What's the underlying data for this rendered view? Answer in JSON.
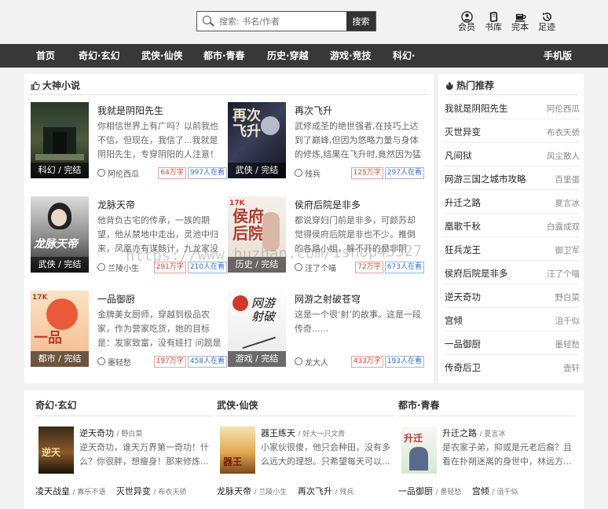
{
  "header": {
    "search_placeholder": "搜索: 书名/作者",
    "search_button": "搜索",
    "user_links": [
      {
        "label": "会员",
        "icon": "user-icon"
      },
      {
        "label": "书库",
        "icon": "book-icon"
      },
      {
        "label": "完本",
        "icon": "cup-icon"
      },
      {
        "label": "足迹",
        "icon": "history-icon"
      }
    ]
  },
  "nav": {
    "items": [
      "首页",
      "奇幻·玄幻",
      "武侠·仙侠",
      "都市·青春",
      "历史·穿越",
      "游戏·竞技",
      "科幻·"
    ],
    "mobile": "手机版"
  },
  "featured": {
    "title": "大神小说",
    "books": [
      {
        "title": "我就是阴阳先生",
        "desc": "你相信世界上有广吗？以前我也不信，但现在，我信了...我就是阴阳先生，专穿阴阳的人注意！书中...",
        "author": "阿伦西瓜",
        "words": "64万字",
        "readers": "997人在看",
        "tag": "科幻 / 完结"
      },
      {
        "title": "再次飞升",
        "desc": "武修成圣的绝世强者,在技巧上达到了巅峰,但因为悠略力量与身体的修炼,结果在飞升时,竟然因为猛烈的...",
        "author": "残兵",
        "words": "125万字",
        "readers": "297人在看",
        "tag": "武侠 / 完结"
      },
      {
        "title": "龙脉天帝",
        "desc": "他背负古宅的传承，一族的期望，他从禁地中走出，灵池中归来，凤凰亦有谋骸计，九龙家没有骚...",
        "author": "兰陵小生",
        "words": "291万字",
        "readers": "210人在看",
        "tag": "武侠 / 完结"
      },
      {
        "title": "侯府后院是非多",
        "desc": "都说穿妇门前是非多，可颜苏却觉得侯府后院是非也不少。推倒的各路小姐，躲不开的是非阴谋，我...",
        "author": "汪了个喵",
        "words": "72万字",
        "readers": "673人在看",
        "tag": "历史 / 完结"
      },
      {
        "title": "一品御厨",
        "desc": "金牌美女厨师，穿越到极品农家，作为营家吃货，她的目标是：发家致富，没有娃打 问题是身边有许...",
        "author": "墨轻愁",
        "words": "197万字",
        "readers": "458人在看",
        "tag": "都市 / 完结"
      },
      {
        "title": "网游之射破苍穹",
        "desc": "这是一个很‘射’的故事。这是一段传奇......",
        "author": "龙大人",
        "words": "433万字",
        "readers": "193人在看",
        "tag": "游戏 / 完结"
      }
    ]
  },
  "hot": {
    "title": "热门推荐",
    "rows": [
      {
        "title": "我就是阴阳先生",
        "author": "阿伦西瓜"
      },
      {
        "title": "灭世异变",
        "author": "布衣天骄"
      },
      {
        "title": "凡间狱",
        "author": "风尘散人"
      },
      {
        "title": "网游三国之城市攻略",
        "author": "百里蛋"
      },
      {
        "title": "升迁之路",
        "author": "夏言冰"
      },
      {
        "title": "凰歌千秋",
        "author": "白露成双"
      },
      {
        "title": "狂兵龙王",
        "author": "御卫军"
      },
      {
        "title": "侯府后院是非多",
        "author": "汪了个喵"
      },
      {
        "title": "逆天奇功",
        "author": "野白菜"
      },
      {
        "title": "宫倾",
        "author": "沮千似"
      },
      {
        "title": "一品御厨",
        "author": "墨轻愁"
      },
      {
        "title": "传奇后卫",
        "author": "壶轩"
      }
    ]
  },
  "categories": [
    {
      "title": "奇幻·玄幻",
      "book": "逆天奇功",
      "author": "野白菜",
      "desc": "逆天奇功，谁天万界第一奇功！什么？你很胖，想瘦身！那来修炼...",
      "links": [
        {
          "title": "凌天战皇",
          "author": "寡乐不语"
        },
        {
          "title": "灭世异变",
          "author": "布衣天骄"
        }
      ]
    },
    {
      "title": "武侠·仙侠",
      "book": "器王练天",
      "author": "好大一只文青",
      "desc": "小家伙很傻，他只会种田，没有多么远大的理想。只希望每天可以...",
      "links": [
        {
          "title": "龙脉天帝",
          "author": "兰陵小生"
        },
        {
          "title": "再次飞升",
          "author": "残兵"
        }
      ]
    },
    {
      "title": "都市·青春",
      "book": "升迁之路",
      "author": "夏言冰",
      "desc": "是农家子弟，抑或是元老后裔？且看在扑朔迷离的身世中，林远方...",
      "links": [
        {
          "title": "一品御厨",
          "author": "墨轻愁"
        },
        {
          "title": "宫倾",
          "author": "沮千似"
        }
      ]
    }
  ],
  "watermark": "https://www.huzhan.com/ishop45527",
  "colors": {
    "nav_bg": "#383838",
    "accent_red": "#d2483a",
    "accent_blue": "#3b6ec8"
  }
}
